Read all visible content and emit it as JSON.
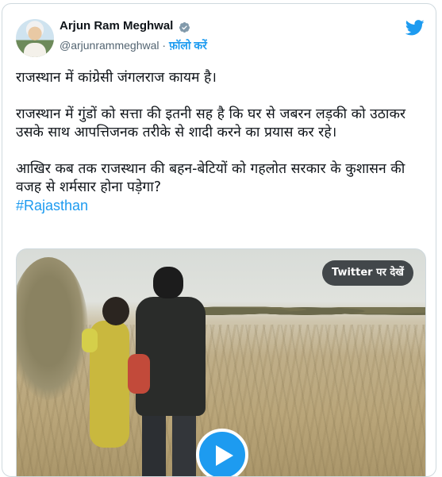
{
  "author": {
    "name": "Arjun Ram Meghwal",
    "handle": "@arjunrammeghwal",
    "separator": "·",
    "follow_label": "फ़ॉलो करें"
  },
  "tweet": {
    "paragraphs": [
      "राजस्थान में कांग्रेसी जंगलराज कायम है।",
      "राजस्थान में गुंडों को सत्ता की इतनी सह है कि घर से जबरन लड़की को उठाकर उसके साथ आपत्तिजनक तरीके से शादी करने का प्रयास कर रहे।",
      "आखिर कब तक राजस्थान की बहन-बेटियों को गहलोत सरकार के कुशासन की वजह से शर्मसार होना पड़ेगा?"
    ],
    "hashtag": "#Rajasthan"
  },
  "media": {
    "view_on_twitter_label": "Twitter पर देखें"
  },
  "icons": {
    "verified": "verified-badge-icon",
    "twitter": "twitter-bird-icon",
    "play": "play-icon"
  },
  "colors": {
    "accent": "#1d9bf0",
    "text": "#0f1419",
    "muted": "#536471",
    "border": "#cfd9de"
  }
}
